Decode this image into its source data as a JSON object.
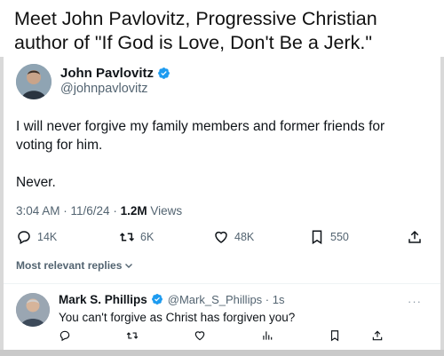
{
  "caption": "Meet John Pavlovitz, Progressive Christian author of \"If God is Love, Don't Be a Jerk.\"",
  "tweet": {
    "author_name": "John Pavlovitz",
    "handle": "@johnpavlovitz",
    "verified": true,
    "body": [
      "I will never forgive my family members and former friends for voting for him.",
      "Never."
    ],
    "timestamp": "3:04 AM · 11/6/24 · ",
    "views_count": "1.2M",
    "views_label": " Views",
    "stats": {
      "replies": "14K",
      "reposts": "6K",
      "likes": "48K",
      "bookmarks": "550"
    }
  },
  "replies_sort_label": "Most relevant replies",
  "reply": {
    "author_name": "Mark S. Phillips",
    "handle_time": "@Mark_S_Phillips · 1s",
    "verified": true,
    "text": "You can't forgive as Christ has forgiven you?"
  },
  "colors": {
    "verified_blue": "#1d9bf0",
    "secondary_text": "#536471",
    "primary_text": "#0f1419"
  },
  "icons": [
    "verified-icon",
    "reply-icon",
    "repost-icon",
    "like-icon",
    "bookmark-icon",
    "share-icon",
    "views-icon",
    "chevron-down-icon",
    "more-icon"
  ]
}
